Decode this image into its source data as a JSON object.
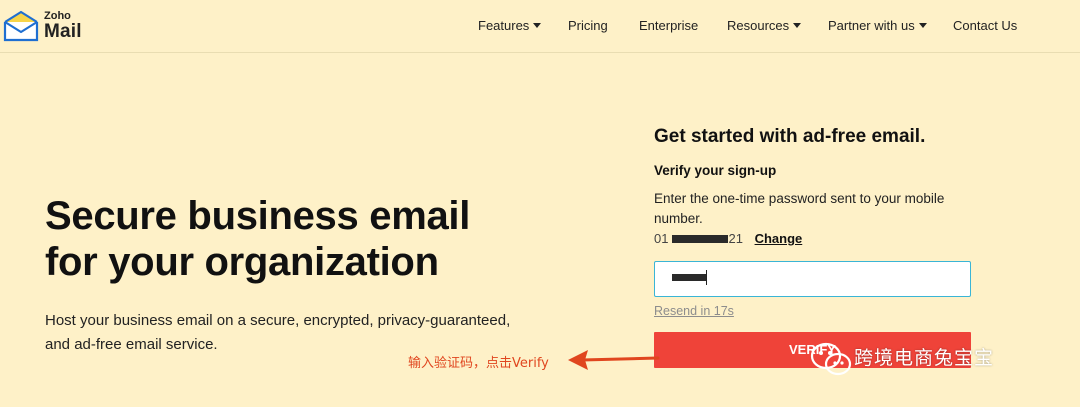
{
  "brand": {
    "small": "Zoho",
    "name": "Mail"
  },
  "nav": [
    {
      "label": "Features",
      "dropdown": true
    },
    {
      "label": "Pricing",
      "dropdown": false
    },
    {
      "label": "Enterprise",
      "dropdown": false
    },
    {
      "label": "Resources",
      "dropdown": true
    },
    {
      "label": "Partner with us",
      "dropdown": true
    },
    {
      "label": "Contact Us",
      "dropdown": false
    }
  ],
  "hero": {
    "title_line1": "Secure business email",
    "title_line2": "for your organization",
    "description_line1": "Host your business email on a secure, encrypted, privacy-guaranteed,",
    "description_line2": "and ad-free email service."
  },
  "signup": {
    "title": "Get started with ad-free email.",
    "verify_heading": "Verify your sign-up",
    "verify_text": "Enter the one-time password sent to your mobile number.",
    "phone_prefix": "01",
    "phone_suffix": "21",
    "change_label": "Change",
    "otp_value": "",
    "resend_label": "Resend in 17s",
    "verify_button": "VERIFY"
  },
  "annotation": {
    "text": "输入验证码，点击Verify"
  },
  "watermark": {
    "text": "跨境电商兔宝宝"
  },
  "colors": {
    "background": "#fef1c8",
    "accent_red": "#ef4339",
    "input_border": "#3ab5d6",
    "annotation": "#e0461f"
  }
}
